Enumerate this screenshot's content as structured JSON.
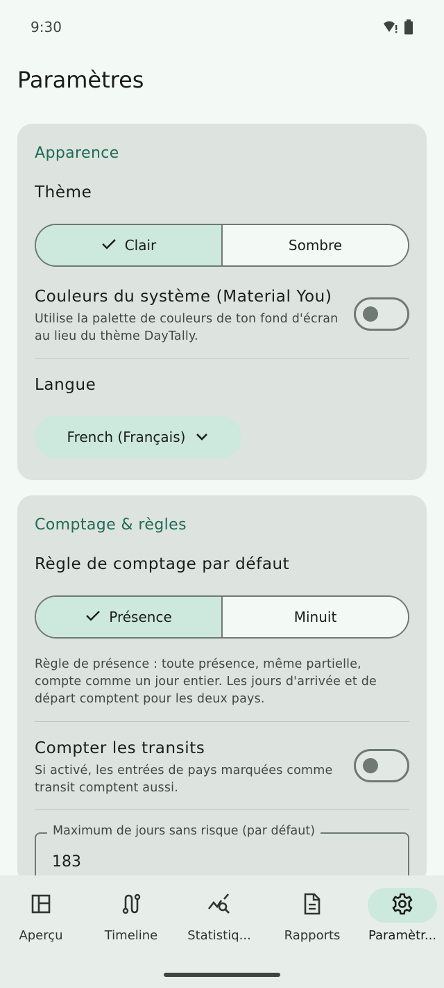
{
  "status_bar": {
    "time": "9:30"
  },
  "page": {
    "title": "Paramètres"
  },
  "appearance": {
    "section_title": "Apparence",
    "theme_label": "Thème",
    "theme_options": {
      "light": "Clair",
      "dark": "Sombre",
      "selected": "light"
    },
    "system_colors": {
      "title": "Couleurs du système (Material You)",
      "description_line1": "Utilise la palette de couleurs de ton fond d'écran",
      "description_line2": "au lieu du thème DayTally.",
      "enabled": false
    },
    "language_label": "Langue",
    "language_value": "French (Français)"
  },
  "counting": {
    "section_title": "Comptage & règles",
    "rule_label": "Règle de comptage par défaut",
    "rule_options": {
      "presence": "Présence",
      "midnight": "Minuit",
      "selected": "presence"
    },
    "rule_description_line1": "Règle de présence : toute présence, même partielle,",
    "rule_description_line2": "compte comme un jour entier. Les jours d'arrivée et de",
    "rule_description_line3": "départ comptent pour les deux pays.",
    "transits": {
      "title": "Compter les transits",
      "description_line1": "Si activé, les entrées de pays marquées comme",
      "description_line2": "transit comptent aussi.",
      "enabled": false
    },
    "max_days_field": {
      "label": "Maximum de jours sans risque (par défaut)",
      "value": "183"
    }
  },
  "bottom_nav": {
    "items": [
      {
        "label": "Aperçu",
        "icon": "dashboard-icon"
      },
      {
        "label": "Timeline",
        "icon": "route-icon"
      },
      {
        "label": "Statistiq...",
        "icon": "query-stats-icon"
      },
      {
        "label": "Rapports",
        "icon": "description-icon"
      },
      {
        "label": "Paramètr...",
        "icon": "settings-icon",
        "active": true
      }
    ]
  },
  "colors": {
    "background": "#f3f9f5",
    "card": "#dde3df",
    "accent": "#1e6b57",
    "selected_container": "#cde8dd",
    "outline": "#6f7975"
  }
}
